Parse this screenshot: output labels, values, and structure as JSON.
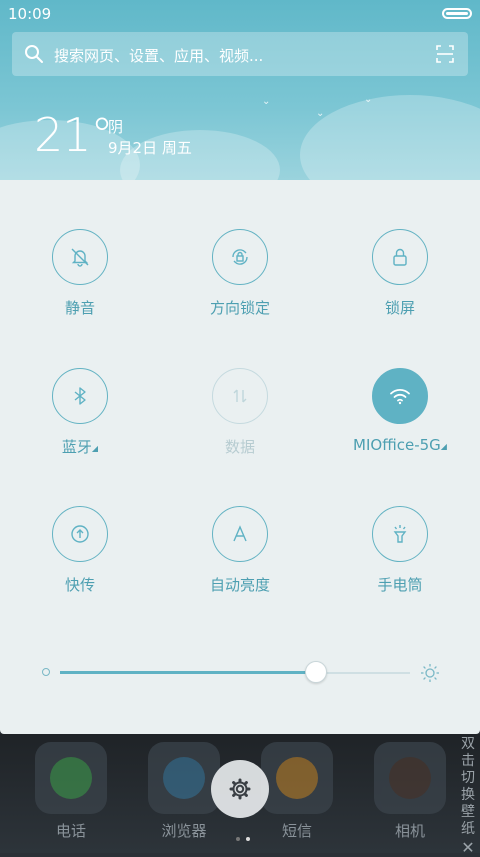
{
  "status_bar": {
    "time": "10:09"
  },
  "search": {
    "placeholder": "搜索网页、设置、应用、视频..."
  },
  "weather": {
    "temperature": "21°",
    "condition": "阴",
    "date": "9月2日 周五"
  },
  "toggles": [
    {
      "label": "静音",
      "icon": "bell-muted-icon",
      "state": "off"
    },
    {
      "label": "方向锁定",
      "icon": "rotation-lock-icon",
      "state": "off"
    },
    {
      "label": "锁屏",
      "icon": "lock-icon",
      "state": "off"
    },
    {
      "label": "蓝牙",
      "icon": "bluetooth-icon",
      "state": "off"
    },
    {
      "label": "数据",
      "icon": "mobile-data-icon",
      "state": "disabled"
    },
    {
      "label": "MIOffice-5G",
      "icon": "wifi-icon",
      "state": "on"
    },
    {
      "label": "快传",
      "icon": "transfer-icon",
      "state": "off"
    },
    {
      "label": "自动亮度",
      "icon": "auto-brightness-icon",
      "state": "off"
    },
    {
      "label": "手电筒",
      "icon": "flashlight-icon",
      "state": "off"
    }
  ],
  "brightness": {
    "level": 0.73
  },
  "dock": {
    "apps": [
      "电话",
      "浏览器",
      "短信",
      "相机"
    ]
  },
  "side_hint": {
    "text": "双击切换壁纸",
    "close": "✕"
  },
  "colors": {
    "accent": "#5fb2c4",
    "panel": "#eaf0f1",
    "header": "#6cbfcd"
  }
}
